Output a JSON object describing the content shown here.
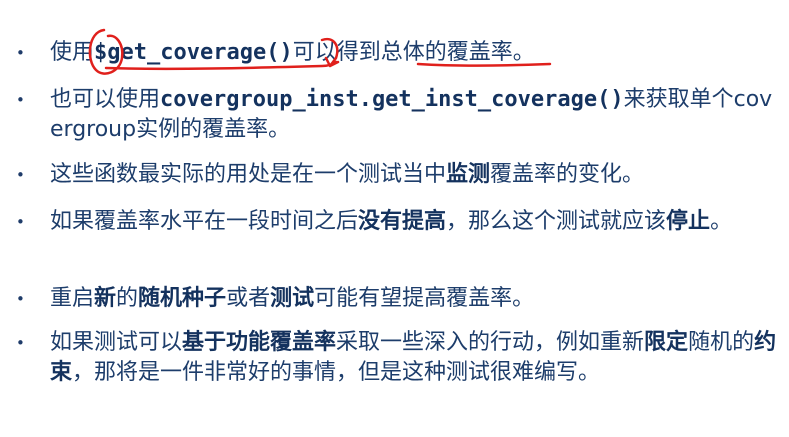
{
  "bullets": [
    {
      "segments": [
        {
          "text": "使用",
          "bold": false
        },
        {
          "text": "$get_coverage()",
          "bold": true
        },
        {
          "text": "可以得到总体的覆盖率。",
          "bold": false
        }
      ]
    },
    {
      "segments": [
        {
          "text": "也可以使用",
          "bold": false
        },
        {
          "text": "covergroup_inst.get_inst_coverage()",
          "bold": true
        },
        {
          "text": "来获取单个covergroup实例的覆盖率。",
          "bold": false
        }
      ]
    },
    {
      "segments": [
        {
          "text": "这些函数最实际的用处是在一个测试当中",
          "bold": false
        },
        {
          "text": "监测",
          "bold": true
        },
        {
          "text": "覆盖率的变化。",
          "bold": false
        }
      ]
    },
    {
      "segments": [
        {
          "text": "如果覆盖率水平在一段时间之后",
          "bold": false
        },
        {
          "text": "没有提高",
          "bold": true
        },
        {
          "text": "，那么这个测试就应该",
          "bold": false
        },
        {
          "text": "停止",
          "bold": true
        },
        {
          "text": "。",
          "bold": false
        }
      ]
    },
    {
      "segments": [
        {
          "text": "重启",
          "bold": false
        },
        {
          "text": "新",
          "bold": true
        },
        {
          "text": "的",
          "bold": false
        },
        {
          "text": "随机种子",
          "bold": true
        },
        {
          "text": "或者",
          "bold": false
        },
        {
          "text": "测试",
          "bold": true
        },
        {
          "text": "可能有望提高覆盖率。",
          "bold": false
        }
      ]
    },
    {
      "segments": [
        {
          "text": "如果测试可以",
          "bold": false
        },
        {
          "text": "基于功能覆盖率",
          "bold": true
        },
        {
          "text": "采取一些深入的行动，例如重新",
          "bold": false
        },
        {
          "text": "限定",
          "bold": true
        },
        {
          "text": "随机的",
          "bold": false
        },
        {
          "text": "约束",
          "bold": true
        },
        {
          "text": "，那将是一件非常好的事情，但是这种测试很难编写。",
          "bold": false
        }
      ]
    }
  ],
  "bullet_symbol": "•",
  "colors": {
    "text": "#1d3d6b",
    "annotation": "#e0201c"
  }
}
